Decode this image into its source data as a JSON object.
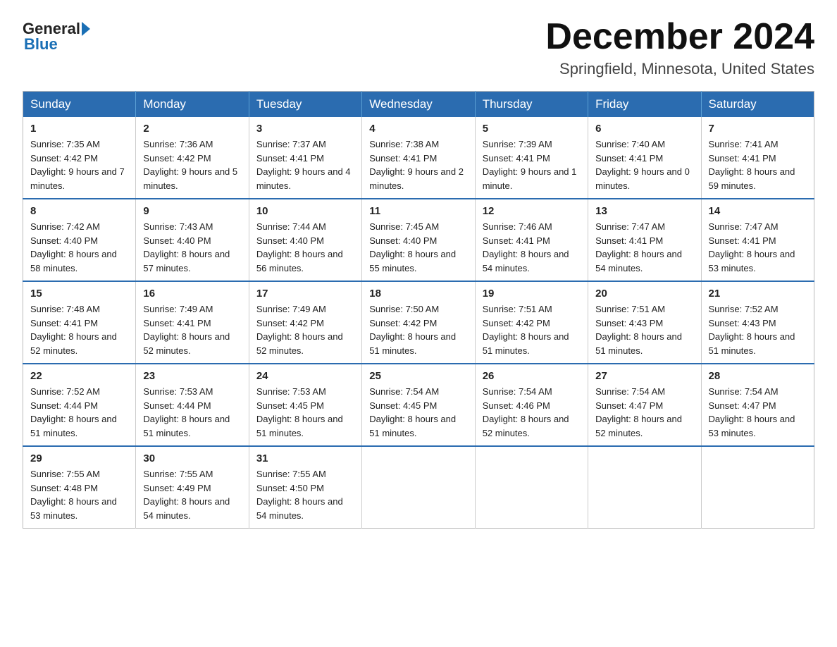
{
  "header": {
    "title": "December 2024",
    "subtitle": "Springfield, Minnesota, United States",
    "logo_general": "General",
    "logo_blue": "Blue"
  },
  "weekdays": [
    "Sunday",
    "Monday",
    "Tuesday",
    "Wednesday",
    "Thursday",
    "Friday",
    "Saturday"
  ],
  "weeks": [
    [
      {
        "day": "1",
        "sunrise": "7:35 AM",
        "sunset": "4:42 PM",
        "daylight": "9 hours and 7 minutes."
      },
      {
        "day": "2",
        "sunrise": "7:36 AM",
        "sunset": "4:42 PM",
        "daylight": "9 hours and 5 minutes."
      },
      {
        "day": "3",
        "sunrise": "7:37 AM",
        "sunset": "4:41 PM",
        "daylight": "9 hours and 4 minutes."
      },
      {
        "day": "4",
        "sunrise": "7:38 AM",
        "sunset": "4:41 PM",
        "daylight": "9 hours and 2 minutes."
      },
      {
        "day": "5",
        "sunrise": "7:39 AM",
        "sunset": "4:41 PM",
        "daylight": "9 hours and 1 minute."
      },
      {
        "day": "6",
        "sunrise": "7:40 AM",
        "sunset": "4:41 PM",
        "daylight": "9 hours and 0 minutes."
      },
      {
        "day": "7",
        "sunrise": "7:41 AM",
        "sunset": "4:41 PM",
        "daylight": "8 hours and 59 minutes."
      }
    ],
    [
      {
        "day": "8",
        "sunrise": "7:42 AM",
        "sunset": "4:40 PM",
        "daylight": "8 hours and 58 minutes."
      },
      {
        "day": "9",
        "sunrise": "7:43 AM",
        "sunset": "4:40 PM",
        "daylight": "8 hours and 57 minutes."
      },
      {
        "day": "10",
        "sunrise": "7:44 AM",
        "sunset": "4:40 PM",
        "daylight": "8 hours and 56 minutes."
      },
      {
        "day": "11",
        "sunrise": "7:45 AM",
        "sunset": "4:40 PM",
        "daylight": "8 hours and 55 minutes."
      },
      {
        "day": "12",
        "sunrise": "7:46 AM",
        "sunset": "4:41 PM",
        "daylight": "8 hours and 54 minutes."
      },
      {
        "day": "13",
        "sunrise": "7:47 AM",
        "sunset": "4:41 PM",
        "daylight": "8 hours and 54 minutes."
      },
      {
        "day": "14",
        "sunrise": "7:47 AM",
        "sunset": "4:41 PM",
        "daylight": "8 hours and 53 minutes."
      }
    ],
    [
      {
        "day": "15",
        "sunrise": "7:48 AM",
        "sunset": "4:41 PM",
        "daylight": "8 hours and 52 minutes."
      },
      {
        "day": "16",
        "sunrise": "7:49 AM",
        "sunset": "4:41 PM",
        "daylight": "8 hours and 52 minutes."
      },
      {
        "day": "17",
        "sunrise": "7:49 AM",
        "sunset": "4:42 PM",
        "daylight": "8 hours and 52 minutes."
      },
      {
        "day": "18",
        "sunrise": "7:50 AM",
        "sunset": "4:42 PM",
        "daylight": "8 hours and 51 minutes."
      },
      {
        "day": "19",
        "sunrise": "7:51 AM",
        "sunset": "4:42 PM",
        "daylight": "8 hours and 51 minutes."
      },
      {
        "day": "20",
        "sunrise": "7:51 AM",
        "sunset": "4:43 PM",
        "daylight": "8 hours and 51 minutes."
      },
      {
        "day": "21",
        "sunrise": "7:52 AM",
        "sunset": "4:43 PM",
        "daylight": "8 hours and 51 minutes."
      }
    ],
    [
      {
        "day": "22",
        "sunrise": "7:52 AM",
        "sunset": "4:44 PM",
        "daylight": "8 hours and 51 minutes."
      },
      {
        "day": "23",
        "sunrise": "7:53 AM",
        "sunset": "4:44 PM",
        "daylight": "8 hours and 51 minutes."
      },
      {
        "day": "24",
        "sunrise": "7:53 AM",
        "sunset": "4:45 PM",
        "daylight": "8 hours and 51 minutes."
      },
      {
        "day": "25",
        "sunrise": "7:54 AM",
        "sunset": "4:45 PM",
        "daylight": "8 hours and 51 minutes."
      },
      {
        "day": "26",
        "sunrise": "7:54 AM",
        "sunset": "4:46 PM",
        "daylight": "8 hours and 52 minutes."
      },
      {
        "day": "27",
        "sunrise": "7:54 AM",
        "sunset": "4:47 PM",
        "daylight": "8 hours and 52 minutes."
      },
      {
        "day": "28",
        "sunrise": "7:54 AM",
        "sunset": "4:47 PM",
        "daylight": "8 hours and 53 minutes."
      }
    ],
    [
      {
        "day": "29",
        "sunrise": "7:55 AM",
        "sunset": "4:48 PM",
        "daylight": "8 hours and 53 minutes."
      },
      {
        "day": "30",
        "sunrise": "7:55 AM",
        "sunset": "4:49 PM",
        "daylight": "8 hours and 54 minutes."
      },
      {
        "day": "31",
        "sunrise": "7:55 AM",
        "sunset": "4:50 PM",
        "daylight": "8 hours and 54 minutes."
      },
      null,
      null,
      null,
      null
    ]
  ]
}
